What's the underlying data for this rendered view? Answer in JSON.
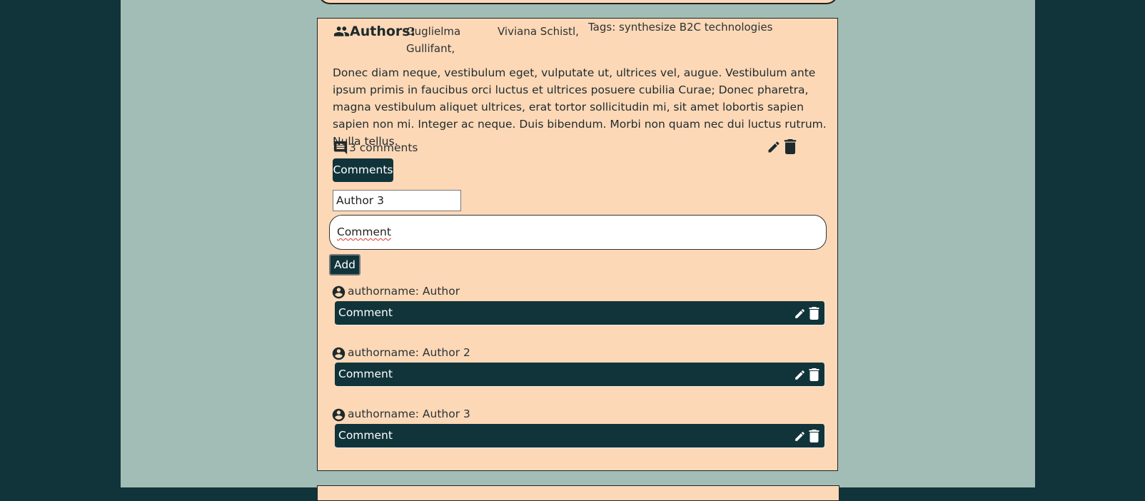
{
  "post": {
    "authors_label": "Authors:",
    "authors": [
      "Guglielma Gullifant,",
      "Viviana Schistl,"
    ],
    "tags": "Tags: synthesize B2C technologies",
    "body": "Donec diam neque, vestibulum eget, vulputate ut, ultrices vel, augue. Vestibulum ante ipsum primis in faucibus orci luctus et ultrices posuere cubilia Curae; Donec pharetra, magna vestibulum aliquet ultrices, erat tortor sollicitudin mi, sit amet lobortis sapien sapien non mi. Integer ac neque. Duis bibendum. Morbi non quam nec dui luctus rutrum. Nulla tellus.",
    "comment_count": "3 comments",
    "comments_button": "Comments"
  },
  "form": {
    "author_value": "Author 3",
    "comment_value": "Comment",
    "add_button": "Add"
  },
  "comments": [
    {
      "author_line": "authorname: Author",
      "text": "Comment"
    },
    {
      "author_line": "authorname: Author 2",
      "text": "Comment"
    },
    {
      "author_line": "authorname: Author 3",
      "text": "Comment"
    }
  ],
  "icons": {
    "authors": "people-icon",
    "comment_count": "comment-icon",
    "edit": "pencil-icon",
    "delete": "trash-icon",
    "author": "account-circle-icon"
  },
  "colors": {
    "outer_bg": "#11343b",
    "column_bg": "#a2bdb5",
    "card_bg": "#fdd8b7",
    "dark_accent": "#11343b"
  }
}
